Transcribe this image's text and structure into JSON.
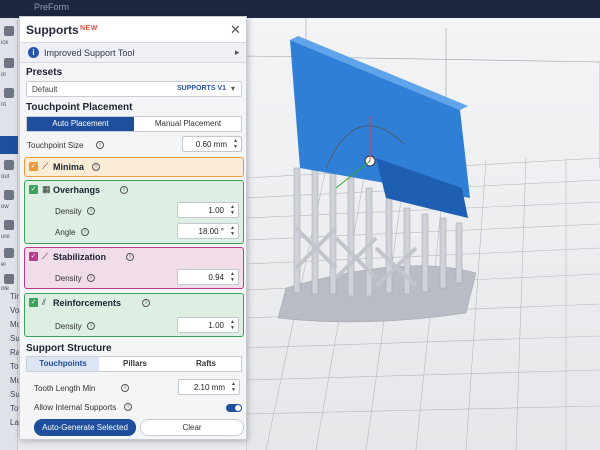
{
  "app": {
    "title": "PreForm"
  },
  "rail": {
    "labels": [
      "ick",
      "ol",
      "nt",
      "out",
      "ow",
      "ure",
      "el",
      "ole"
    ]
  },
  "sidebar_col": {
    "items": [
      "Tim",
      "Vol",
      "Mo",
      "Sup",
      "Ra",
      "Tot",
      "Mo",
      "Su",
      "Tot",
      "Lay"
    ]
  },
  "panel": {
    "title": "Supports",
    "badge": "NEW",
    "info_label": "Improved Support Tool",
    "presets": {
      "title": "Presets",
      "value": "Default",
      "tag": "SUPPORTS V1"
    },
    "touchpoint_placement": {
      "title": "Touchpoint Placement",
      "auto_label": "Auto Placement",
      "manual_label": "Manual Placement",
      "size_label": "Touchpoint Size",
      "size_value": "0.60 mm"
    },
    "minima": {
      "title": "Minima"
    },
    "overhangs": {
      "title": "Overhangs",
      "density_label": "Density",
      "density_value": "1.00",
      "angle_label": "Angle",
      "angle_value": "18.00 °"
    },
    "stabilization": {
      "title": "Stabilization",
      "density_label": "Density",
      "density_value": "0.94"
    },
    "reinforcements": {
      "title": "Reinforcements",
      "density_label": "Density",
      "density_value": "1.00"
    },
    "support_structure": {
      "title": "Support Structure",
      "tabs": [
        "Touchpoints",
        "Pillars",
        "Rafts"
      ],
      "tooth_label": "Tooth Length Min",
      "tooth_value": "2.10 mm",
      "internal_label": "Allow Internal Supports"
    },
    "buttons": {
      "generate": "Auto-Generate Selected",
      "clear": "Clear"
    }
  },
  "colors": {
    "accent": "#1f4f9c",
    "minima": "#e89a3c",
    "overhangs": "#3da25d",
    "stabilization": "#b73a8e",
    "reinforcements": "#3da25d",
    "model": "#2f7fd6"
  },
  "icons": [
    "close-icon",
    "info-icon",
    "chevron-right-icon",
    "chevron-down-icon",
    "check-icon",
    "gizmo-icon"
  ]
}
